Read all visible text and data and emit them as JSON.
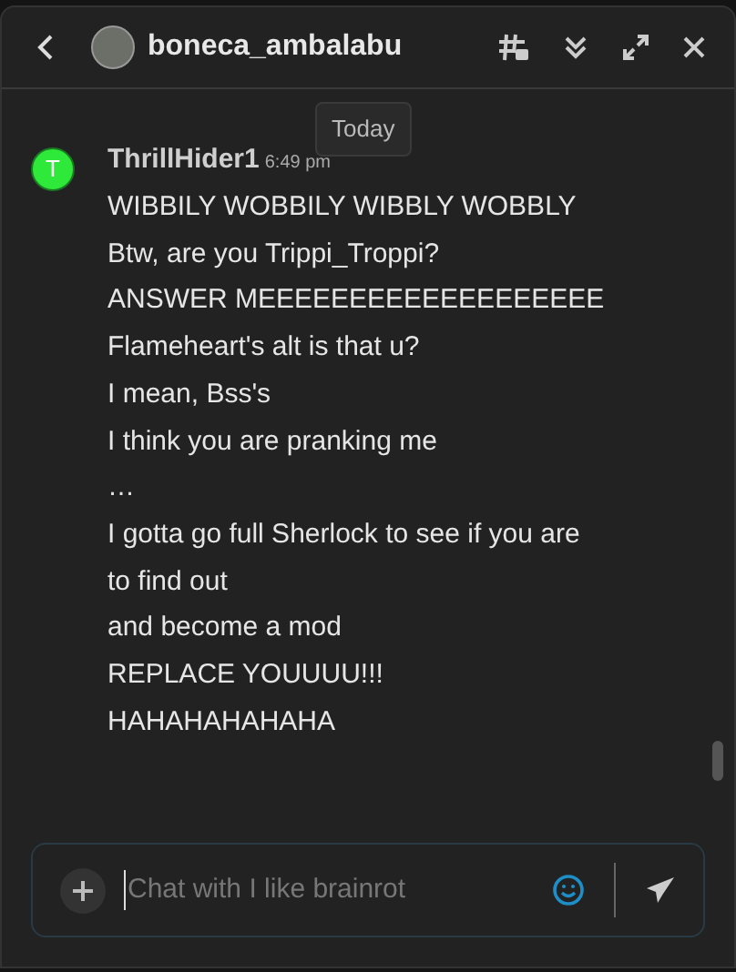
{
  "header": {
    "title": "boneca_ambalabu"
  },
  "tooltip": "Today",
  "message": {
    "avatar_letter": "T",
    "author": "ThrillHider1",
    "time": "6:49 pm",
    "lines": [
      "WIBBILY WOBBILY WIBBLY WOBBLY",
      "Btw, are you Trippi_Troppi?",
      "ANSWER MEEEEEEEEEEEEEEEEEEE",
      "Flameheart's alt is that u?",
      "I mean, Bss's",
      "I think you are pranking me",
      "…",
      "I gotta go full Sherlock to see if you are",
      "to find out",
      "and become a mod",
      "REPLACE YOUUUU!!!",
      "HAHAHAHAHAHA"
    ]
  },
  "composer": {
    "placeholder": "Chat with I like brainrot"
  }
}
